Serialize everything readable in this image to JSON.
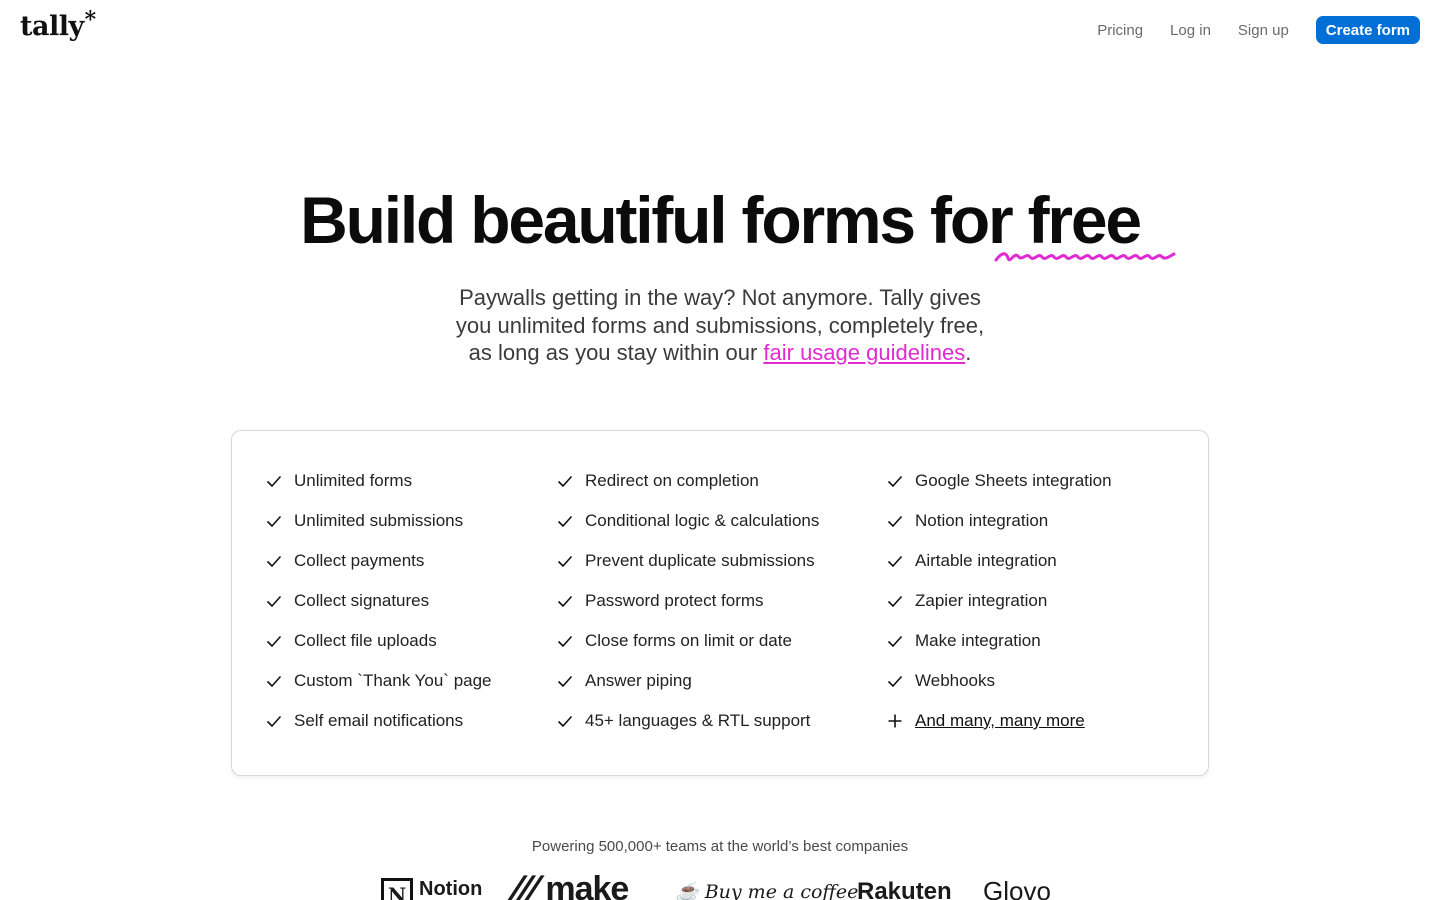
{
  "nav": {
    "logo": "tally",
    "logo_star": "*",
    "links": [
      "Pricing",
      "Log in",
      "Sign up"
    ],
    "cta": "Create form"
  },
  "hero": {
    "title": "Build beautiful forms for free",
    "subtitle_line1": "Paywalls getting in the way? Not anymore. Tally gives",
    "subtitle_line2": "you unlimited forms and submissions, completely free,",
    "subtitle_line3_prefix": "as long as you stay within our ",
    "subtitle_link": "fair usage guidelines",
    "subtitle_line3_suffix": ".",
    "accent_color": "#e02ad4"
  },
  "features": {
    "col1": [
      "Unlimited forms",
      "Unlimited submissions",
      "Collect payments",
      "Collect signatures",
      "Collect file uploads",
      "Custom `Thank You` page",
      "Self email notifications"
    ],
    "col2": [
      "Redirect on completion",
      "Conditional logic & calculations",
      "Prevent duplicate submissions",
      "Password protect forms",
      "Close forms on limit or date",
      "Answer piping",
      "45+ languages & RTL support"
    ],
    "col3": [
      "Google Sheets integration",
      "Notion integration",
      "Airtable integration",
      "Zapier integration",
      "Make integration",
      "Webhooks"
    ],
    "more": "And many, many more"
  },
  "social_proof": {
    "text": "Powering 500,000+ teams at the world’s best companies",
    "logos": [
      "Notion",
      "make",
      "Buy me a coffee",
      "Rakuten",
      "Glovo"
    ]
  },
  "colors": {
    "cta_bg": "#0070d7",
    "text": "#0b0b0b"
  }
}
